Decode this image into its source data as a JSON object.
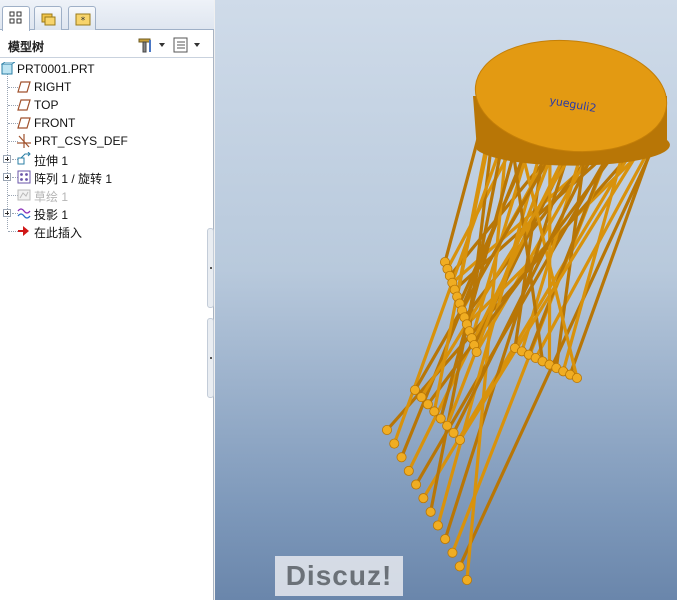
{
  "tree": {
    "title": "模型树",
    "items": [
      {
        "label": "PRT0001.PRT",
        "icon": "part-icon",
        "expandable": false,
        "dim": false
      },
      {
        "label": "RIGHT",
        "icon": "datum-plane-icon",
        "expandable": false,
        "dim": false
      },
      {
        "label": "TOP",
        "icon": "datum-plane-icon",
        "expandable": false,
        "dim": false
      },
      {
        "label": "FRONT",
        "icon": "datum-plane-icon",
        "expandable": false,
        "dim": false
      },
      {
        "label": "PRT_CSYS_DEF",
        "icon": "csys-icon",
        "expandable": false,
        "dim": false
      },
      {
        "label": "拉伸 1",
        "icon": "extrude-icon",
        "expandable": true,
        "dim": false
      },
      {
        "label": "阵列 1 / 旋转 1",
        "icon": "pattern-icon",
        "expandable": true,
        "dim": false
      },
      {
        "label": "草绘 1",
        "icon": "sketch-icon",
        "expandable": false,
        "dim": true
      },
      {
        "label": "投影 1",
        "icon": "project-icon",
        "expandable": true,
        "dim": false
      },
      {
        "label": "在此插入",
        "icon": "insert-here-icon",
        "expandable": false,
        "dim": false
      }
    ]
  },
  "viewport": {
    "disk_text": "yueguli2",
    "colors": {
      "model": "#d8920c",
      "model_dark": "#b87606",
      "model_light": "#f0ad22",
      "text": "#2a3aa8"
    }
  },
  "watermark": "Discuz!"
}
